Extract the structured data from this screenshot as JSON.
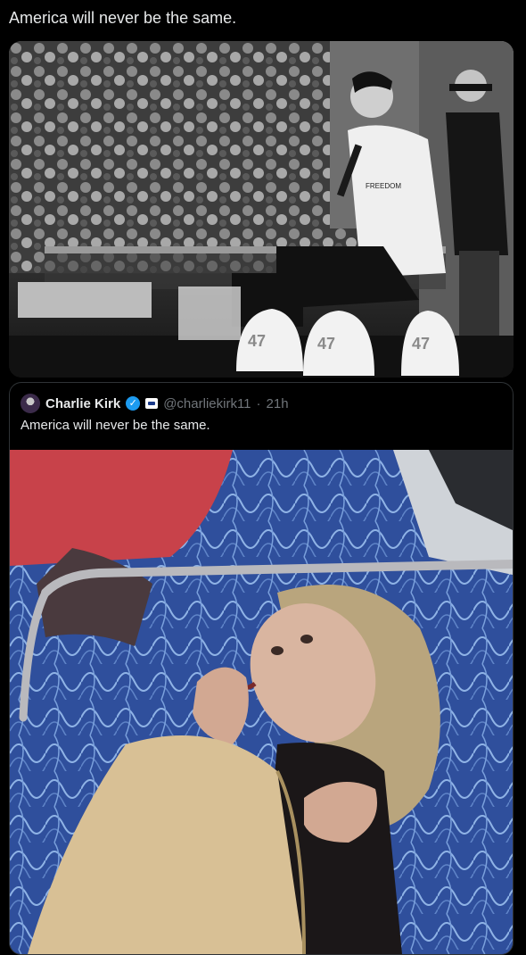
{
  "post": {
    "text": "America will never be the same."
  },
  "quoted": {
    "author_name": "Charlie Kirk",
    "handle": "@charliekirk11",
    "separator": "·",
    "time": "21h",
    "text": "America will never be the same."
  },
  "photo_bw": {
    "cap_label": "47",
    "shirt_text": "FREEDOM"
  },
  "colors": {
    "background": "#000000",
    "text": "#e7e9ea",
    "muted": "#71767b",
    "verified": "#1d9bf0",
    "card_border": "#2f3336"
  }
}
